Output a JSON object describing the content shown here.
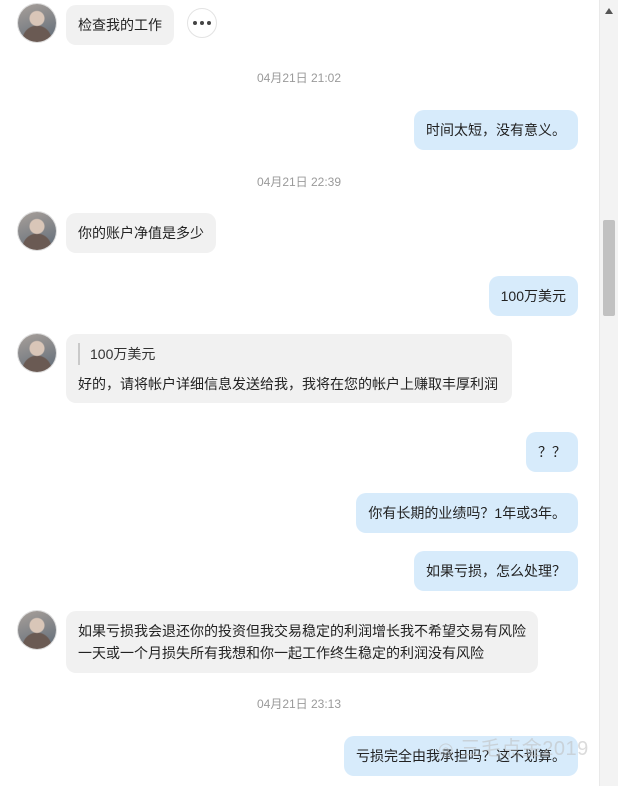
{
  "messages": [
    {
      "dir": "in",
      "text": "检查我的工作"
    },
    {
      "type": "time",
      "text": "04月21日 21:02"
    },
    {
      "dir": "out",
      "text": "时间太短，没有意义。"
    },
    {
      "type": "time",
      "text": "04月21日 22:39"
    },
    {
      "dir": "in",
      "text": "你的账户净值是多少"
    },
    {
      "dir": "out",
      "text": "100万美元"
    },
    {
      "dir": "in",
      "quote": "100万美元",
      "text": "好的，请将帐户详细信息发送给我，我将在您的帐户上赚取丰厚利润"
    },
    {
      "dir": "out",
      "text": "？？"
    },
    {
      "dir": "out",
      "text": "你有长期的业绩吗？1年或3年。"
    },
    {
      "dir": "out",
      "text": "如果亏损，怎么处理？"
    },
    {
      "dir": "in",
      "text_line1": "如果亏损我会退还你的投资但我交易稳定的利润增长我不希望交易有风险",
      "text_line2": "一天或一个月损失所有我想和你一起工作终生稳定的利润没有风险"
    },
    {
      "type": "time",
      "text": "04月21日 23:13"
    },
    {
      "dir": "out",
      "text": "亏损完全由我承担吗？这不划算。"
    }
  ],
  "watermark": "三毛点金2019",
  "icons": {
    "more": "more-dots-icon",
    "scroll": "scroll-up-arrow-icon"
  }
}
